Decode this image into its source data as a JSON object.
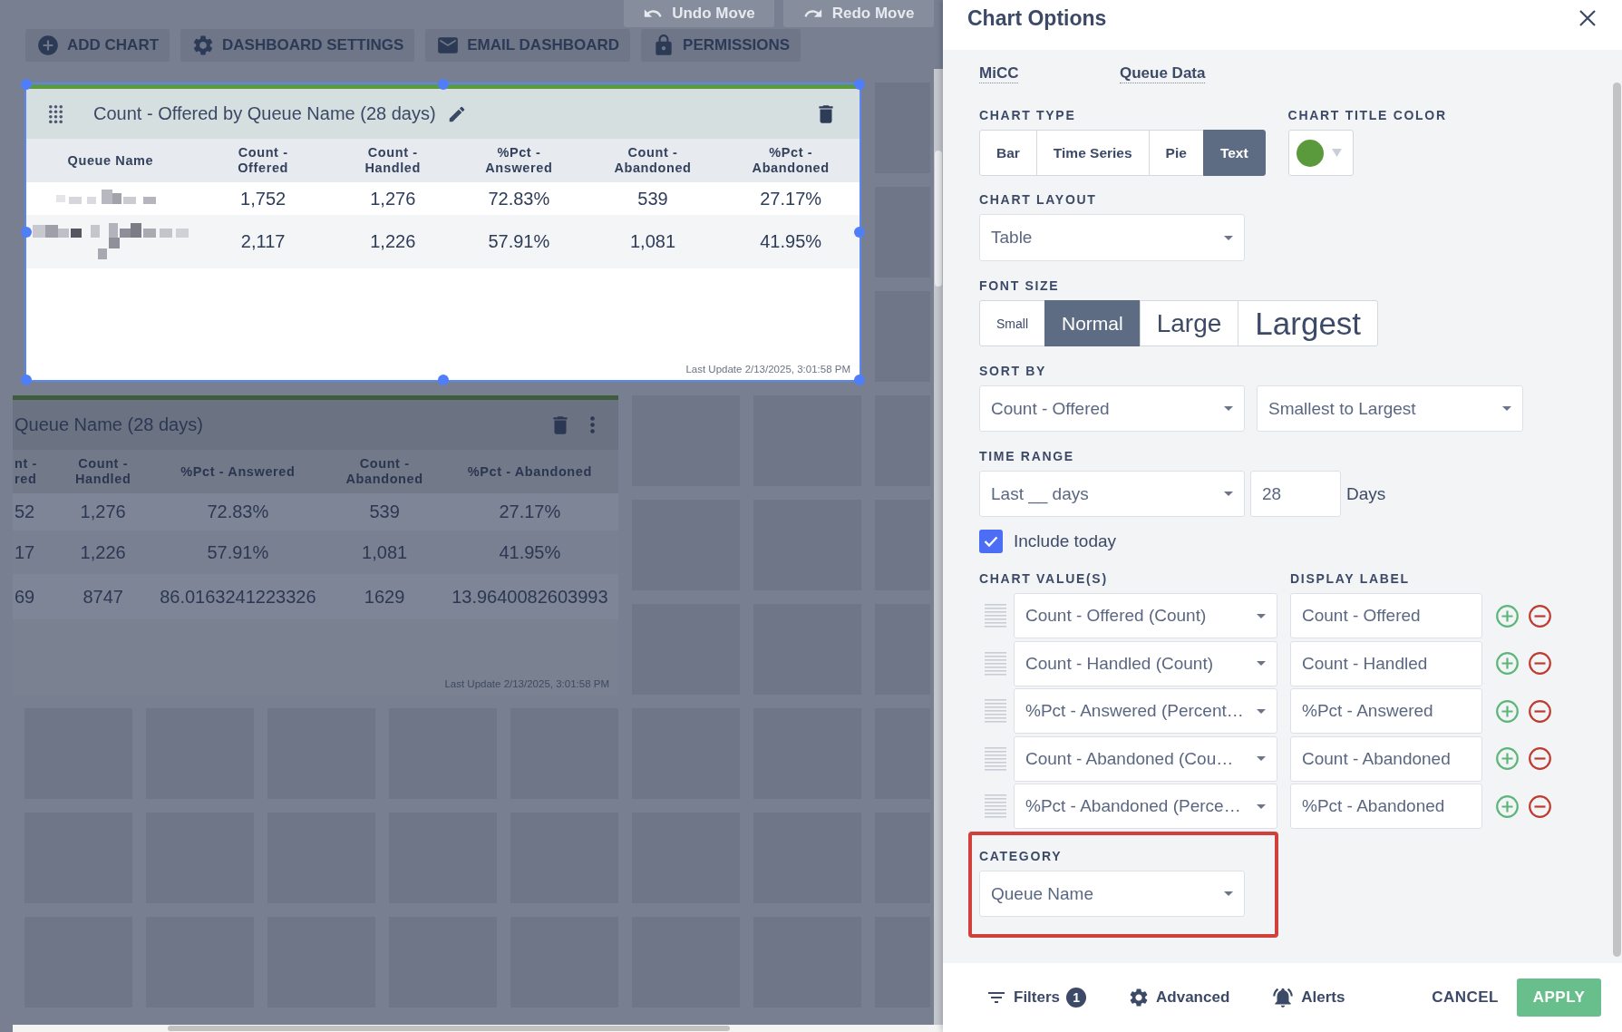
{
  "toolbar": {
    "buttons": [
      {
        "label": "ADD CHART",
        "kind": "add"
      },
      {
        "label": "DASHBOARD SETTINGS",
        "kind": "settings"
      },
      {
        "label": "EMAIL DASHBOARD",
        "kind": "email"
      },
      {
        "label": "PERMISSIONS",
        "kind": "permissions"
      }
    ]
  },
  "history": [
    {
      "label": "Undo Move",
      "kind": "undo"
    },
    {
      "label": "Redo Move",
      "kind": "redo"
    }
  ],
  "dashboard": {
    "cards": [
      {
        "title": "Count - Offered by Queue Name (28 days)",
        "selected": true,
        "columns": [
          {
            "label": "Queue Name",
            "kind": "redacted"
          },
          {
            "label": "Count - Offered",
            "kind": "value"
          },
          {
            "label": "Count - Handled",
            "kind": "value"
          },
          {
            "label": "%Pct - Answered",
            "kind": "value"
          },
          {
            "label": "Count - Abandoned",
            "kind": "value"
          },
          {
            "label": "%Pct - Abandoned",
            "kind": "value"
          }
        ],
        "rows": [
          {
            "values": [
              "1,752",
              "1,276",
              "72.83%",
              "539",
              "27.17%"
            ]
          },
          {
            "values": [
              "2,117",
              "1,226",
              "57.91%",
              "1,081",
              "41.95%"
            ]
          }
        ],
        "last_update": "Last Update 2/13/2025, 3:01:58 PM"
      },
      {
        "title": "Queue Name (28 days)",
        "selected": false,
        "columns": [
          {
            "label": "nt - red",
            "kind": "value"
          },
          {
            "label": "Count - Handled",
            "kind": "value"
          },
          {
            "label": "%Pct - Answered",
            "kind": "value"
          },
          {
            "label": "Count - Abandoned",
            "kind": "value"
          },
          {
            "label": "%Pct - Abandoned",
            "kind": "value"
          }
        ],
        "rows": [
          {
            "values": [
              "52",
              "1,276",
              "72.83%",
              "539",
              "27.17%"
            ]
          },
          {
            "values": [
              "17",
              "1,226",
              "57.91%",
              "1,081",
              "41.95%"
            ]
          },
          {
            "values": [
              "69",
              "8747",
              "86.0163241223326",
              "1629",
              "13.9640082603993"
            ]
          }
        ],
        "last_update": "Last Update 2/13/2025, 3:01:58 PM"
      }
    ]
  },
  "panel": {
    "title": "Chart Options",
    "sources": [
      {
        "label": "MiCC"
      },
      {
        "label": "Queue Data"
      }
    ],
    "chart_type": {
      "label": "CHART TYPE",
      "options": [
        {
          "label": "Bar",
          "selected": false
        },
        {
          "label": "Time Series",
          "selected": false
        },
        {
          "label": "Pie",
          "selected": false
        },
        {
          "label": "Text",
          "selected": true
        }
      ]
    },
    "title_color": {
      "label": "CHART TITLE COLOR",
      "color": "#5a9a3c"
    },
    "chart_layout": {
      "label": "CHART LAYOUT",
      "value": "Table"
    },
    "font_size": {
      "label": "FONT SIZE",
      "options": [
        {
          "label": "Small",
          "selected": false
        },
        {
          "label": "Normal",
          "selected": true
        },
        {
          "label": "Large",
          "selected": false
        },
        {
          "label": "Largest",
          "selected": false
        }
      ]
    },
    "sort_by": {
      "label": "SORT BY",
      "field": "Count - Offered",
      "order": "Smallest to Largest"
    },
    "time_range": {
      "label": "TIME RANGE",
      "period": "Last __ days",
      "count": "28",
      "unit": "Days"
    },
    "include_today": {
      "label": "Include today",
      "checked": true
    },
    "chart_values": {
      "value_heading": "CHART VALUE(S)",
      "label_heading": "DISPLAY LABEL",
      "rows": [
        {
          "value": "Count - Offered (Count)",
          "label": "Count - Offered"
        },
        {
          "value": "Count - Handled (Count)",
          "label": "Count - Handled"
        },
        {
          "value": "%Pct - Answered (Percent…",
          "label": "%Pct - Answered"
        },
        {
          "value": "Count - Abandoned (Cou…",
          "label": "Count - Abandoned"
        },
        {
          "value": "%Pct - Abandoned (Perce…",
          "label": "%Pct - Abandoned"
        }
      ]
    },
    "category": {
      "label": "CATEGORY",
      "value": "Queue Name",
      "highlighted": true
    }
  },
  "footer": {
    "tools": [
      {
        "label": "Filters",
        "kind": "filters",
        "badge": "1"
      },
      {
        "label": "Advanced",
        "kind": "advanced"
      },
      {
        "label": "Alerts",
        "kind": "alerts"
      }
    ],
    "cancel": "CANCEL",
    "apply": "APPLY"
  }
}
